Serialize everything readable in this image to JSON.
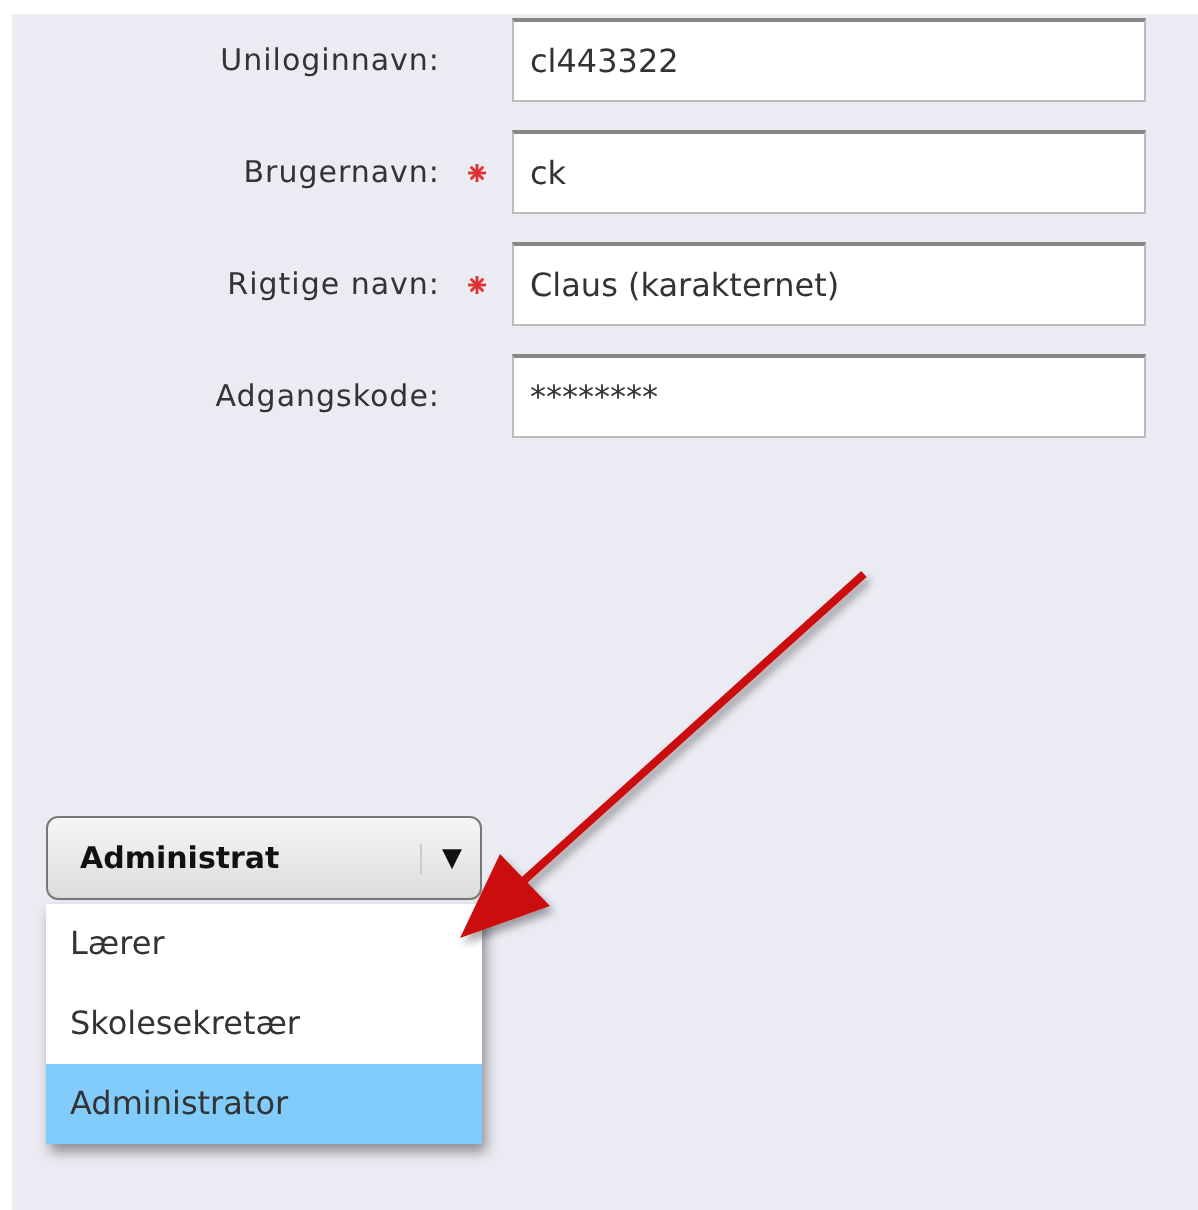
{
  "form": {
    "fields": [
      {
        "label": "Uniloginnavn:",
        "required": false,
        "value": "cl443322"
      },
      {
        "label": "Brugernavn:",
        "required": true,
        "value": "ck"
      },
      {
        "label": "Rigtige navn:",
        "required": true,
        "value": "Claus (karakternet)"
      },
      {
        "label": "Adgangskode:",
        "required": false,
        "value": "********"
      }
    ]
  },
  "role_dropdown": {
    "value": "Administrat",
    "caret": "▼",
    "expanded": true,
    "options": [
      {
        "label": "Lærer",
        "selected": false
      },
      {
        "label": "Skolesekretær",
        "selected": false
      },
      {
        "label": "Administrator",
        "selected": true
      }
    ]
  }
}
